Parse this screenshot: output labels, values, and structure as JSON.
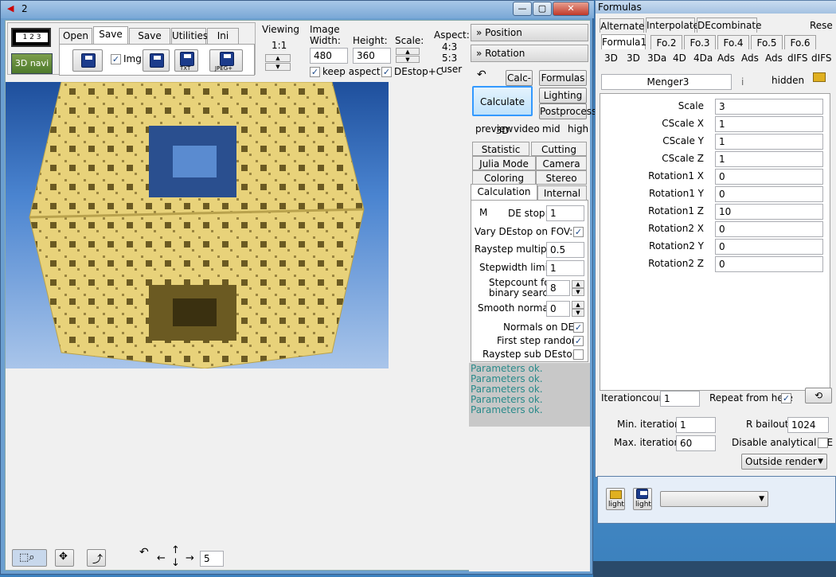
{
  "main_window": {
    "title": "2",
    "controls": {
      "minimize": "—",
      "maximize": "▢",
      "close": "✕"
    }
  },
  "toolbar": {
    "navi_label": "3D navi",
    "tabs": [
      "Open",
      "Save",
      "Save pic",
      "Utilities",
      "Ini"
    ],
    "selected_tab": "Save",
    "img_checkbox_label": "Img",
    "img_checked": "✓",
    "icon_labels": {
      "txt": "TXT",
      "jpeg": "JPEG+"
    },
    "viewing": {
      "title": "Viewing",
      "ratio": "1:1"
    },
    "image": {
      "title": "Image",
      "width_label": "Width:",
      "height_label": "Height:",
      "scale_label": "Scale:",
      "aspect_label": "Aspect:",
      "width": "480",
      "height": "360",
      "aspect_options": [
        "4:3",
        "5:3",
        "user"
      ],
      "keep_aspect_label": "keep aspect",
      "destop_label": "DEstop+C",
      "keep_aspect_checked": "✓",
      "destop_checked": "✓"
    }
  },
  "right_panel": {
    "position_label": "» Position",
    "rotation_label": "» Rotation",
    "undo": "↶",
    "calc_minus": "Calc-",
    "formulas_btn": "Formulas",
    "calculate_btn": "Calculate 3D",
    "lighting_btn": "Lighting",
    "postprocess_btn": "Postprocess",
    "quality": [
      "preview",
      "video",
      "mid",
      "high"
    ],
    "tabs_row1": [
      "Statistic",
      "Cutting"
    ],
    "tabs_row2": [
      "Julia Mode",
      "Camera"
    ],
    "tabs_row3": [
      "Coloring",
      "Stereo"
    ],
    "tabs_row4": [
      "Calculation",
      "Internal"
    ],
    "selected_tab": "Calculation",
    "calc": {
      "m_label": "M",
      "de_stop_label": "DE stop:",
      "de_stop": "1",
      "vary_label": "Vary DEstop on FOV:",
      "vary_checked": "✓",
      "raystep_label": "Raystep multiplier:",
      "raystep": "0.5",
      "stepwidth_label": "Stepwidth limiter:",
      "stepwidth": "1",
      "stepcount_label_1": "Stepcount for",
      "stepcount_label_2": "binary search:",
      "stepcount": "8",
      "smooth_label": "Smooth  normals:",
      "smooth": "0",
      "normals_label": "Normals on DE:",
      "normals_checked": "✓",
      "first_step_label": "First step random:",
      "first_step_checked": "✓",
      "raystep_sub_label": "Raystep sub DEstop:",
      "raystep_sub_checked": ""
    },
    "messages": [
      "Parameters ok.",
      "Parameters ok.",
      "Parameters ok.",
      "Parameters ok.",
      "Parameters ok."
    ]
  },
  "bottom_bar": {
    "rotate_icon": "↶",
    "value": "5"
  },
  "formulas_window": {
    "title": "Formulas",
    "top_tabs": [
      "Alternate",
      "Interpolate",
      "DEcombinate",
      "Rese"
    ],
    "formula_tabs": [
      "Formula1",
      "Fo.2",
      "Fo.3",
      "Fo.4",
      "Fo.5",
      "Fo.6"
    ],
    "selected_formula": "Formula1",
    "type_tabs": [
      "3D",
      "3D",
      "3Da",
      "4D",
      "4Da",
      "Ads",
      "Ads",
      "Ads",
      "dIFS",
      "dIFS"
    ],
    "formula_name": "Menger3",
    "info": "i",
    "hidden_label": "hidden",
    "params": [
      {
        "label": "Scale",
        "value": "3"
      },
      {
        "label": "CScale X",
        "value": "1"
      },
      {
        "label": "CScale Y",
        "value": "1"
      },
      {
        "label": "CScale Z",
        "value": "1"
      },
      {
        "label": "Rotation1 X",
        "value": "0"
      },
      {
        "label": "Rotation1 Y",
        "value": "0"
      },
      {
        "label": "Rotation1 Z",
        "value": "10"
      },
      {
        "label": "Rotation2 X",
        "value": "0"
      },
      {
        "label": "Rotation2 Y",
        "value": "0"
      },
      {
        "label": "Rotation2 Z",
        "value": "0"
      }
    ],
    "iterationcount_label": "Iterationcount:",
    "iterationcount": "1",
    "repeat_label": "Repeat from here",
    "repeat_checked": "✓",
    "min_iter_label": "Min. iterations:",
    "min_iter": "1",
    "max_iter_label": "Max. iterations:",
    "max_iter": "60",
    "rbailout_label": "R bailout:",
    "rbailout": "1024",
    "disable_de_label": "Disable analytical DE",
    "disable_de_checked": "",
    "outside_render": "Outside render"
  },
  "light_window": {
    "light_label_1": "light",
    "light_label_2": "light",
    "dropdown_value": ""
  },
  "colors": {
    "accent": "#3399ff",
    "message": "#2a8a8a",
    "fractal": "#e8d27a"
  }
}
